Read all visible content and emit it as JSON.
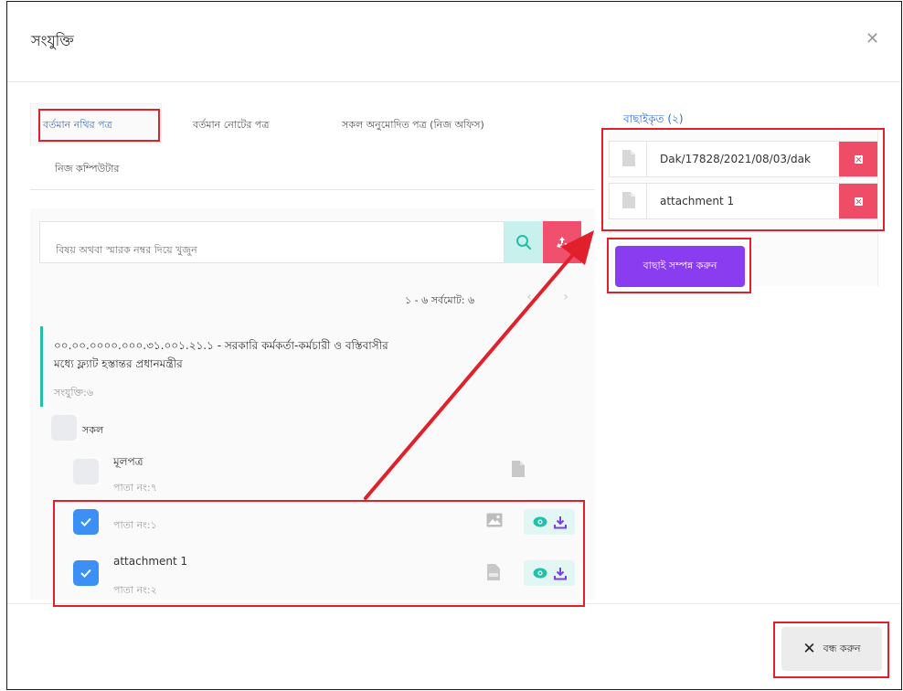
{
  "dialog": {
    "title": "সংযুক্তি"
  },
  "tabs": [
    {
      "label": "বর্তমান নথির পত্র",
      "active": true
    },
    {
      "label": "বর্তমান নোটের পত্র",
      "active": false
    },
    {
      "label": "সকল অনুমোদিত পত্র (নিজ অফিস)",
      "active": false
    },
    {
      "label": "নিজ কম্পিউটার",
      "active": false
    }
  ],
  "search": {
    "placeholder": "বিষয় অথবা স্মারক নম্বর দিয়ে খুজুন"
  },
  "pagination": {
    "summary": "১ - ৬ সর্বমোট: ৬"
  },
  "nothi": {
    "title": "০০.০০.০০০০.০০০.৩১.০০১.২১.১ - সরকারি কর্মকর্তা-কর্মচারী ও বস্তিবাসীর মধ্যে ফ্ল্যাট হস্তান্তর প্রধানমন্ত্রীর",
    "attachments_count": "সংযুক্তি:৬"
  },
  "select_all_label": "সকল",
  "items": [
    {
      "title": "মূলপত্র",
      "page": "পাতা নং:৭",
      "checked": false,
      "file_icon": "document-icon"
    },
    {
      "title": "",
      "page": "পাতা নং:১",
      "checked": true,
      "file_icon": "image-icon"
    },
    {
      "title": "attachment 1",
      "page": "পাতা নং:২",
      "checked": true,
      "file_icon": "pdf-icon"
    }
  ],
  "selected": {
    "heading": "বাছাইকৃত (২)",
    "items": [
      {
        "name": "Dak/17828/2021/08/03/dak"
      },
      {
        "name": "attachment 1"
      }
    ],
    "confirm_label": "বাছাই সম্পন্ন করুন"
  },
  "footer": {
    "close_label": "বন্ধ করুন"
  },
  "colors": {
    "primary": "#3b74d4",
    "accent_purple": "#8a3cf0",
    "danger": "#ef4c67",
    "teal": "#23bfa9",
    "annotation_red": "#e0202a"
  }
}
